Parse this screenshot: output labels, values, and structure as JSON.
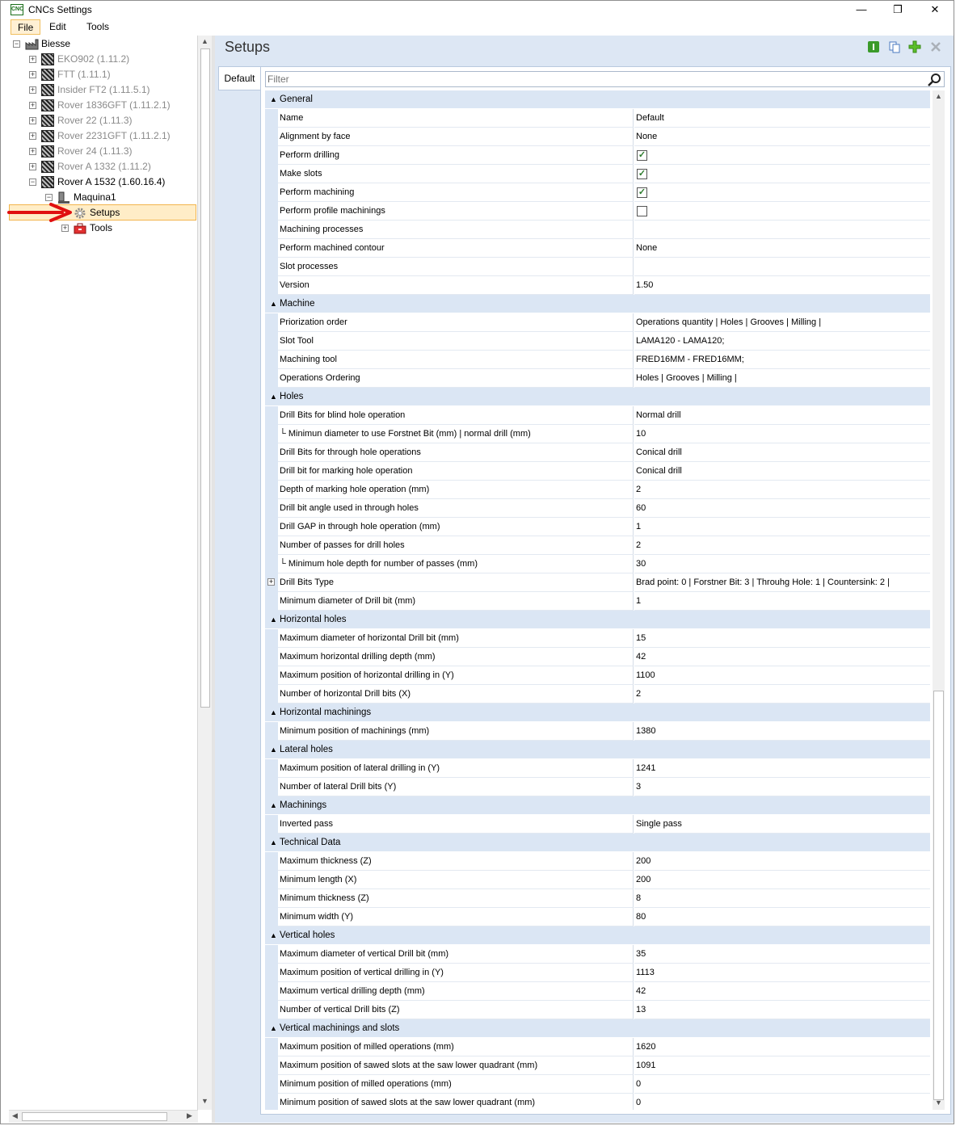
{
  "window": {
    "title": "CNCs Settings",
    "icon_text": "CNC",
    "min": "—",
    "max": "❐",
    "close": "✕"
  },
  "menu": {
    "file": "File",
    "edit": "Edit",
    "tools": "Tools"
  },
  "tree": {
    "root": "Biesse",
    "machines": [
      "EKO902 (1.11.2)",
      "FTT (1.11.1)",
      "Insider FT2 (1.11.5.1)",
      "Rover 1836GFT (1.11.2.1)",
      "Rover 22 (1.11.3)",
      "Rover 2231GFT (1.11.2.1)",
      "Rover 24 (1.11.3)",
      "Rover A 1332 (1.11.2)",
      "Rover A 1532 (1.60.16.4)"
    ],
    "maquina": "Maquina1",
    "setups": "Setups",
    "tools": "Tools"
  },
  "main": {
    "title": "Setups",
    "tab": "Default",
    "filter_placeholder": "Filter"
  },
  "grid": [
    {
      "category": "General",
      "rows": [
        {
          "name": "Name",
          "value": "Default"
        },
        {
          "name": "Alignment by face",
          "value": "None"
        },
        {
          "name": "Perform drilling",
          "checked": true
        },
        {
          "name": "Make slots",
          "checked": true
        },
        {
          "name": "Perform machining",
          "checked": true
        },
        {
          "name": "Perform profile machinings",
          "checked": false
        },
        {
          "name": "Machining processes",
          "value": ""
        },
        {
          "name": "Perform machined contour",
          "value": "None"
        },
        {
          "name": "Slot processes",
          "value": ""
        },
        {
          "name": "Version",
          "value": "1.50"
        }
      ]
    },
    {
      "category": "Machine",
      "rows": [
        {
          "name": "Priorization order",
          "value": "Operations quantity | Holes | Grooves | Milling |"
        },
        {
          "name": "Slot Tool",
          "value": "LAMA120 - LAMA120;"
        },
        {
          "name": "Machining tool",
          "value": "FRED16MM - FRED16MM;"
        },
        {
          "name": "Operations Ordering",
          "value": "Holes | Grooves | Milling |"
        }
      ]
    },
    {
      "category": "Holes",
      "rows": [
        {
          "name": "Drill Bits for blind hole operation",
          "value": "Normal drill"
        },
        {
          "name": "└ Minimun diameter to use Forstnet Bit (mm) | normal drill (mm)",
          "value": "10"
        },
        {
          "name": "Drill Bits for through hole operations",
          "value": "Conical drill"
        },
        {
          "name": "Drill bit for marking hole operation",
          "value": "Conical drill"
        },
        {
          "name": "Depth of marking hole operation (mm)",
          "value": "2"
        },
        {
          "name": "Drill bit angle used in through holes",
          "value": "60"
        },
        {
          "name": "Drill GAP in through hole operation (mm)",
          "value": "1"
        },
        {
          "name": "Number of passes for drill holes",
          "value": "2"
        },
        {
          "name": "└ Minimum hole depth for number of passes (mm)",
          "value": "30"
        },
        {
          "name": "Drill Bits Type",
          "value": "Brad point: 0  |  Forstner Bit: 3  |  Throuhg Hole: 1  |  Countersink: 2  |",
          "expandable": true
        },
        {
          "name": "Minimum diameter of Drill bit (mm)",
          "value": "1"
        }
      ]
    },
    {
      "category": "Horizontal holes",
      "rows": [
        {
          "name": "Maximum diameter of horizontal Drill bit (mm)",
          "value": "15"
        },
        {
          "name": "Maximum horizontal drilling depth (mm)",
          "value": "42"
        },
        {
          "name": "Maximum position of horizontal drilling in (Y)",
          "value": "1100"
        },
        {
          "name": "Number of horizontal Drill bits (X)",
          "value": "2"
        }
      ]
    },
    {
      "category": "Horizontal machinings",
      "rows": [
        {
          "name": "Minimum position of machinings (mm)",
          "value": "1380"
        }
      ]
    },
    {
      "category": "Lateral holes",
      "rows": [
        {
          "name": "Maximum position of lateral drilling in (Y)",
          "value": "1241"
        },
        {
          "name": "Number of lateral Drill bits (Y)",
          "value": "3"
        }
      ]
    },
    {
      "category": "Machinings",
      "rows": [
        {
          "name": "Inverted pass",
          "value": "Single pass"
        }
      ]
    },
    {
      "category": "Technical Data",
      "rows": [
        {
          "name": "Maximum thickness (Z)",
          "value": "200"
        },
        {
          "name": "Minimum length (X)",
          "value": "200"
        },
        {
          "name": "Minimum thickness (Z)",
          "value": "8"
        },
        {
          "name": "Minimum width (Y)",
          "value": "80"
        }
      ]
    },
    {
      "category": "Vertical holes",
      "rows": [
        {
          "name": "Maximum diameter of vertical Drill bit (mm)",
          "value": "35"
        },
        {
          "name": "Maximum position of vertical drilling in (Y)",
          "value": "1113"
        },
        {
          "name": "Maximum vertical drilling depth (mm)",
          "value": "42"
        },
        {
          "name": "Number of vertical Drill bits (Z)",
          "value": "13"
        }
      ]
    },
    {
      "category": "Vertical machinings and slots",
      "rows": [
        {
          "name": "Maximum position of milled operations (mm)",
          "value": "1620"
        },
        {
          "name": "Maximum position of sawed slots at the saw lower quadrant (mm)",
          "value": "1091"
        },
        {
          "name": "Minimum position of milled operations (mm)",
          "value": "0"
        },
        {
          "name": "Minimum position of sawed slots at the saw lower quadrant (mm)",
          "value": "0"
        }
      ]
    }
  ]
}
